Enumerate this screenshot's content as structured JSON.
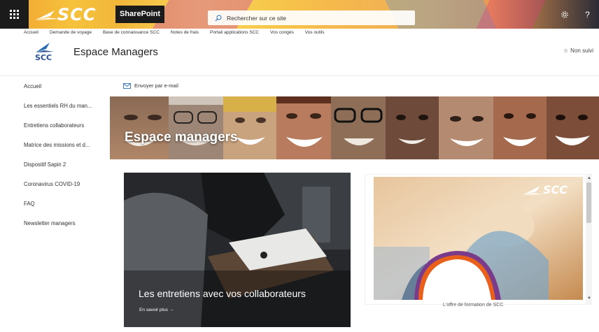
{
  "suite_bar": {
    "brand": "SCC",
    "app_name": "SharePoint",
    "search_placeholder": "Rechercher sur ce site",
    "icons": [
      "waffle-icon",
      "search-icon",
      "settings-icon",
      "help-icon"
    ],
    "help_glyph": "?"
  },
  "hub_nav": {
    "links": [
      "Accueil",
      "Demande de voyage",
      "Base de connaissance SCC",
      "Notes de frais",
      "Portail applications SCC",
      "Vos congés",
      "Vos outils"
    ]
  },
  "site": {
    "logo_text": "SCC",
    "title": "Espace Managers",
    "follow_label": "Non suivi"
  },
  "left_nav": {
    "items": [
      "Accueil",
      "Les essentiels RH du man...",
      "Entretiens collaborateurs",
      "Matrice des missions et d...",
      "Dispositif Sapin 2",
      "Coronavirus COVID-19",
      "FAQ",
      "Newsletter managers"
    ]
  },
  "command_bar": {
    "email_label": "Envoyer par e-mail"
  },
  "hero": {
    "title": "Espace managers"
  },
  "cards": {
    "left": {
      "caption": "Les entretiens avec vos collaborateurs",
      "more_label": "En savoir plus →"
    },
    "right": {
      "logo_text": "SCC",
      "caption": "L'offre de formation de SCC"
    }
  },
  "colors": {
    "suite_gradient_start": "#f0a030",
    "suite_dark": "#1b1b1b",
    "scc_blue": "#2a4e96",
    "link_blue": "#2a6fb5"
  }
}
